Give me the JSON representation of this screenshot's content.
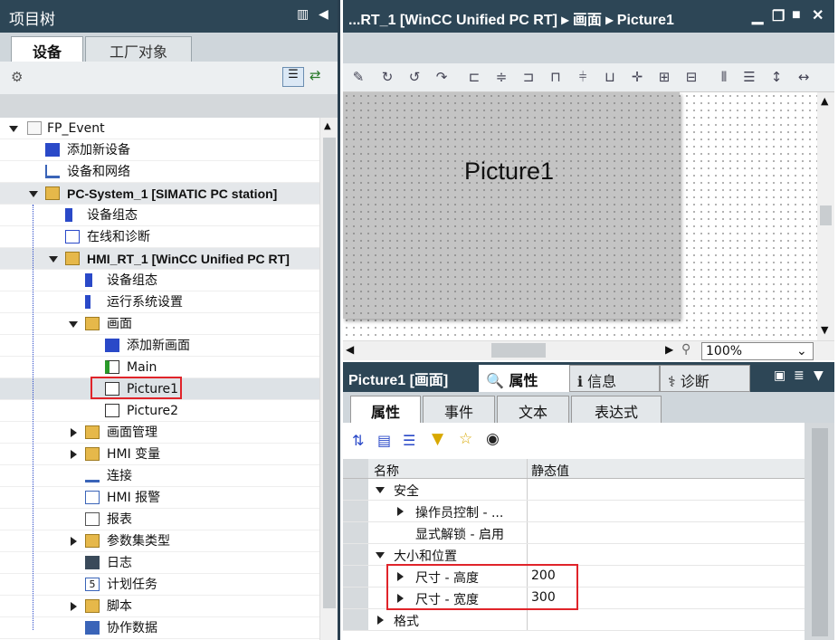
{
  "project_tree": {
    "title": "项目树",
    "tabs": [
      "设备",
      "工厂对象"
    ],
    "items": [
      {
        "label": "FP_Event",
        "bold": false
      },
      {
        "label": "添加新设备",
        "bold": false
      },
      {
        "label": "设备和网络",
        "bold": false
      },
      {
        "label": "PC-System_1 [SIMATIC PC station]",
        "bold": true
      },
      {
        "label": "设备组态",
        "bold": false
      },
      {
        "label": "在线和诊断",
        "bold": false
      },
      {
        "label": "HMI_RT_1 [WinCC Unified PC RT]",
        "bold": true
      },
      {
        "label": "设备组态",
        "bold": false
      },
      {
        "label": "运行系统设置",
        "bold": false
      },
      {
        "label": "画面",
        "bold": false
      },
      {
        "label": "添加新画面",
        "bold": false
      },
      {
        "label": "Main",
        "bold": false
      },
      {
        "label": "Picture1",
        "bold": false
      },
      {
        "label": "Picture2",
        "bold": false
      },
      {
        "label": "画面管理",
        "bold": false
      },
      {
        "label": "HMI 变量",
        "bold": false
      },
      {
        "label": "连接",
        "bold": false
      },
      {
        "label": "HMI 报警",
        "bold": false
      },
      {
        "label": "报表",
        "bold": false
      },
      {
        "label": "参数集类型",
        "bold": false
      },
      {
        "label": "日志",
        "bold": false
      },
      {
        "label": "计划任务",
        "bold": false
      },
      {
        "label": "脚本",
        "bold": false
      },
      {
        "label": "协作数据",
        "bold": false
      }
    ]
  },
  "editor": {
    "breadcrumb": "...RT_1 [WinCC Unified PC RT]  ▸  画面  ▸  Picture1",
    "picture_title": "Picture1",
    "zoom": "100%"
  },
  "inspector": {
    "title": "Picture1 [画面]",
    "tabs": [
      "属性",
      "信息",
      "诊断"
    ],
    "subtabs": [
      "属性",
      "事件",
      "文本",
      "表达式"
    ],
    "columns": [
      "名称",
      "静态值"
    ],
    "rows": [
      {
        "name": "安全",
        "value": ""
      },
      {
        "name": "操作员控制 - ...",
        "value": ""
      },
      {
        "name": "显式解锁 - 启用",
        "value": ""
      },
      {
        "name": "大小和位置",
        "value": ""
      },
      {
        "name": "尺寸 - 高度",
        "value": "200"
      },
      {
        "name": "尺寸 - 宽度",
        "value": "300"
      },
      {
        "name": "格式",
        "value": ""
      }
    ]
  },
  "colors": {
    "titlebar": "#2d4656",
    "highlight": "#e0242a"
  }
}
